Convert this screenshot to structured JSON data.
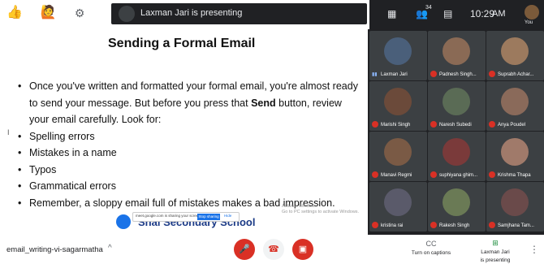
{
  "topbar": {
    "reactions": [
      "👍",
      "🙋"
    ],
    "settings_icon": "gear-icon",
    "presenting_text": "Laxman Jari is presenting",
    "people_count": "34",
    "time": "10:29",
    "ampm": "AM",
    "you_label": "You"
  },
  "slide": {
    "title": "Sending a Formal Email",
    "bullet1_pre": "Once you've written and formatted your formal email, you're almost ready to send your message. But before you press that ",
    "bullet1_bold": "Send",
    "bullet1_post": " button, review your email carefully. Look for:",
    "list": [
      "Spelling errors",
      "Mistakes in a name",
      "Typos",
      "Grammatical errors",
      "Remember, a sloppy email full of mistakes makes a bad impression."
    ],
    "school_text": "Shai Secondary School",
    "share_msg": "meet.google.com is sharing your screen.",
    "stop_sharing": "Stop sharing",
    "hide": "Hide",
    "activate_line1": "Activate Windows",
    "activate_line2": "Go to PC settings to activate Windows."
  },
  "participants": [
    {
      "name": "Laxman Jari",
      "muted": false,
      "color": "#4a5f7a"
    },
    {
      "name": "Padnesh Singh...",
      "muted": true,
      "color": "#8a6a55"
    },
    {
      "name": "Suprabh Achar...",
      "muted": true,
      "color": "#9c7a5e"
    },
    {
      "name": "Marishi Singh",
      "muted": true,
      "color": "#6b4a3a"
    },
    {
      "name": "Naresh Subedi",
      "muted": true,
      "color": "#5a6b55"
    },
    {
      "name": "Anya Poudel",
      "muted": true,
      "color": "#8a6a5a"
    },
    {
      "name": "Manavi Regmi",
      "muted": true,
      "color": "#7a5a45"
    },
    {
      "name": "suphiyana ghim...",
      "muted": true,
      "color": "#7a3a3a"
    },
    {
      "name": "Krishma Thapa",
      "muted": true,
      "color": "#a07a6a"
    },
    {
      "name": "kristina rai",
      "muted": true,
      "color": "#5a5a6a"
    },
    {
      "name": "Rakesh Singh",
      "muted": true,
      "color": "#6a7a55"
    },
    {
      "name": "Samjhana Tam...",
      "muted": true,
      "color": "#6a4a4a"
    }
  ],
  "bottombar": {
    "meeting_code": "email_writing-vi-sagarmatha",
    "captions_label": "Turn on captions",
    "presenting_line1": "Laxman Jari",
    "presenting_line2": "is presenting"
  },
  "colors": {
    "danger": "#d93025",
    "dark": "#202124",
    "accent": "#1a73e8"
  }
}
